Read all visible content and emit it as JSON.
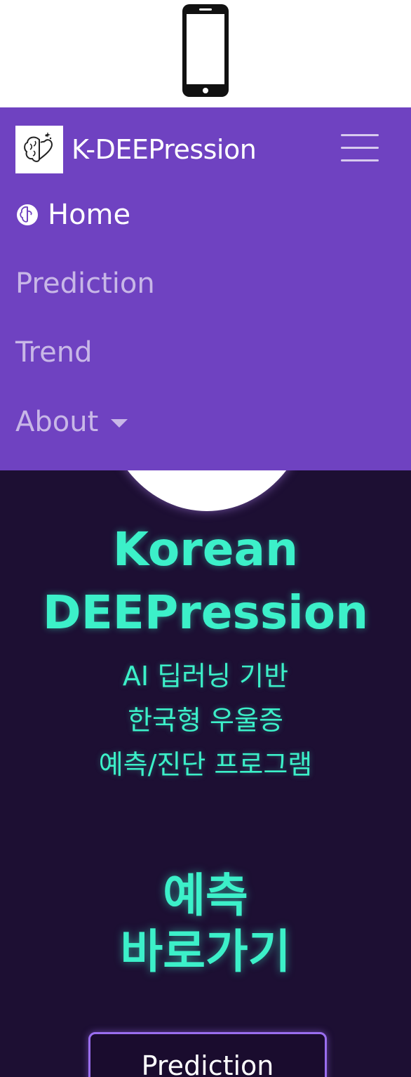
{
  "navbar": {
    "brand": "K-DEEPression",
    "items": [
      {
        "label": "Home",
        "active": true
      },
      {
        "label": "Prediction"
      },
      {
        "label": "Trend"
      },
      {
        "label": "About",
        "dropdown": true
      }
    ]
  },
  "hero": {
    "title_line1": "Korean",
    "title_line2": "DEEPression",
    "subtitle_lines": [
      "AI 딥러닝 기반",
      "한국형 우울증",
      "예측/진단 프로그램"
    ],
    "shortcut_line1": "예측",
    "shortcut_line2": "바로가기",
    "button_label": "Prediction"
  },
  "colors": {
    "navbar_bg": "#6f42c1",
    "hero_bg": "#1d0f33",
    "accent": "#3cf0c9",
    "button_border": "#9a6ef0"
  },
  "icons": [
    "phone-icon",
    "brain-heart-logo-icon",
    "hamburger-menu-icon",
    "brain-icon",
    "caret-down-icon"
  ]
}
